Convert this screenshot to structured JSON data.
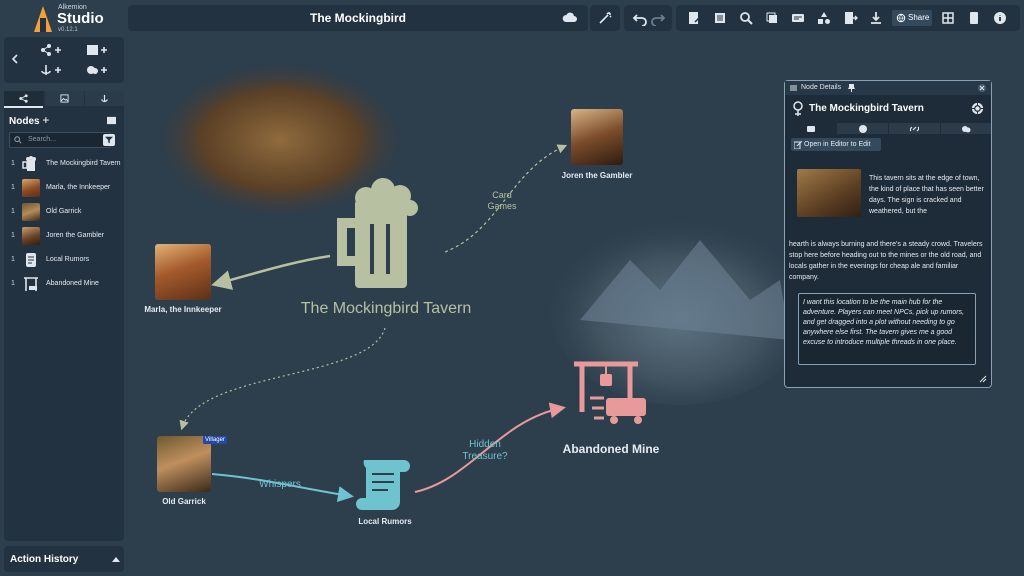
{
  "app": {
    "brand": "Alkemion",
    "name": "Studio",
    "version": "v0.12.1"
  },
  "toolbar": {
    "title": "The Mockingbird",
    "share_label": "Share"
  },
  "sidebar": {
    "nodes_title": "Nodes",
    "search_placeholder": "Search...",
    "items": [
      {
        "num": "1",
        "label": "The Mockingbird Tavern"
      },
      {
        "num": "1",
        "label": "Marla, the Innkeeper"
      },
      {
        "num": "1",
        "label": "Old Garrick"
      },
      {
        "num": "1",
        "label": "Joren the Gambler"
      },
      {
        "num": "1",
        "label": "Local Rumors"
      },
      {
        "num": "1",
        "label": "Abandoned Mine"
      }
    ],
    "action_history": "Action History"
  },
  "canvas": {
    "tavern_label": "The Mockingbird Tavern",
    "marla_label": "Marla, the Innkeeper",
    "joren_label": "Joren the Gambler",
    "garrick_label": "Old Garrick",
    "garrick_badge": "Villager",
    "rumors_label": "Local Rumors",
    "mine_label": "Abandoned Mine",
    "edge_card_line1": "Card",
    "edge_card_line2": "Games",
    "edge_whispers": "Whispers",
    "edge_hidden_line1": "Hidden",
    "edge_hidden_line2": "Treasure?"
  },
  "details": {
    "header": "Node Details",
    "title": "The Mockingbird Tavern",
    "edit_button": "Open in Editor to Edit",
    "description_part1": "This tavern sits at the edge of town, the kind of place that has seen better days. The sign is cracked and weathered, but the",
    "description_part2": "hearth is always burning and there's a steady crowd. Travelers stop here before heading out to the mines or the old road, and locals gather in the evenings for cheap ale and familiar company.",
    "notes": "I want this location to be the main hub for the adventure. Players can meet NPCs, pick up rumors, and get dragged into a plot without needing to go anywhere else first. The tavern gives me a good excuse to introduce multiple threads in one place."
  },
  "colors": {
    "background": "#2d3e4d",
    "tavern_icon": "#b7c0a0",
    "mine_icon": "#e89a9a",
    "rumors_icon": "#6fc3cf",
    "edge_tavern": "#b7c0a0",
    "edge_whispers": "#6fc3cf",
    "edge_hidden": "#e89a9a"
  },
  "icons": [
    "tavern-mug-icon",
    "mine-icon",
    "scroll-icon",
    "cloud-icon",
    "share-icon",
    "pin-icon",
    "location-pin-icon",
    "crosshair-icon",
    "close-icon",
    "search-icon",
    "filter-icon",
    "chevron-up-icon"
  ]
}
